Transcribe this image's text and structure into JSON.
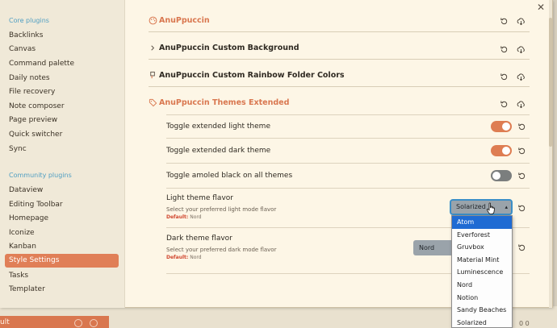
{
  "sidebar": {
    "core_heading": "Core plugins",
    "core_items": [
      "Backlinks",
      "Canvas",
      "Command palette",
      "Daily notes",
      "File recovery",
      "Note composer",
      "Page preview",
      "Quick switcher",
      "Sync"
    ],
    "community_heading": "Community plugins",
    "community_items": [
      "Dataview",
      "Editing Toolbar",
      "Homepage",
      "Iconize",
      "Kanban",
      "Style Settings",
      "Tasks",
      "Templater"
    ],
    "active_item": "Style Settings"
  },
  "sections": {
    "anuppuccin": "AnuPpuccin",
    "custom_background": "AnuPpuccin Custom Background",
    "rainbow_folders": "AnuPpuccin Custom Rainbow Folder Colors",
    "themes_extended": "AnuPpuccin Themes Extended"
  },
  "settings": {
    "toggle_light": {
      "label": "Toggle extended light theme",
      "enabled": true
    },
    "toggle_dark": {
      "label": "Toggle extended dark theme",
      "enabled": true
    },
    "toggle_amoled": {
      "label": "Toggle amoled black on all themes",
      "enabled": false
    },
    "light_flavor": {
      "label": "Light theme flavor",
      "description": "Select your preferred light mode flavor",
      "default_label": "Default:",
      "default_value": "Nord",
      "selected": "Solarized"
    },
    "dark_flavor": {
      "label": "Dark theme flavor",
      "description": "Select your preferred dark mode flavor",
      "default_label": "Default:",
      "default_value": "Nord",
      "selected": "Nord"
    }
  },
  "dropdown": {
    "options": [
      "Atom",
      "Everforest",
      "Gruvbox",
      "Material Mint",
      "Luminescence",
      "Nord",
      "Notion",
      "Sandy Beaches",
      "Solarized"
    ],
    "highlighted": "Atom"
  },
  "background": {
    "left_fragment": "ult",
    "right_fragment": "0 0"
  },
  "colors": {
    "accent": "#de7d52",
    "heading_blue": "#4f9ec2",
    "panel": "#fdf6e6",
    "sidebar": "#f0e9d8",
    "dropdown_highlight": "#1f6bd3"
  }
}
